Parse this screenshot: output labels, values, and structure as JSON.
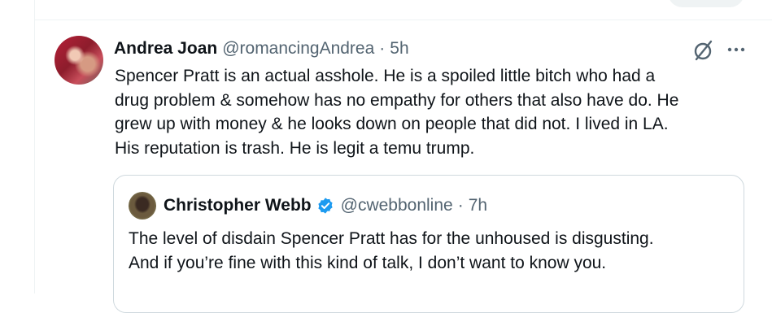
{
  "post": {
    "author_name": "Andrea Joan",
    "author_handle": "@romancingAndrea",
    "separator": "·",
    "timestamp": "5h",
    "text_lines": [
      "Spencer Pratt is an actual asshole. He is a spoiled little bitch who had a",
      "drug problem & somehow has no empathy for others that also have do. He",
      "grew up with money & he looks down on people that did not. I lived in LA.",
      "His reputation is trash. He is legit a temu trump."
    ]
  },
  "quote": {
    "author_name": "Christopher Webb",
    "verified": true,
    "author_handle": "@cwebbonline",
    "separator": "·",
    "timestamp": "7h",
    "text_lines": [
      "The level of disdain Spencer Pratt has for the unhoused is disgusting.",
      "And if you’re fine with this kind of talk, I don’t want to know you."
    ]
  },
  "icons": {
    "grok": "grok-icon",
    "more": "more-options-icon",
    "verified": "verified-badge-icon"
  },
  "colors": {
    "primary_text": "#0f1419",
    "secondary_text": "#536471",
    "verified_blue": "#1d9bf0",
    "border": "#cfd9de"
  }
}
